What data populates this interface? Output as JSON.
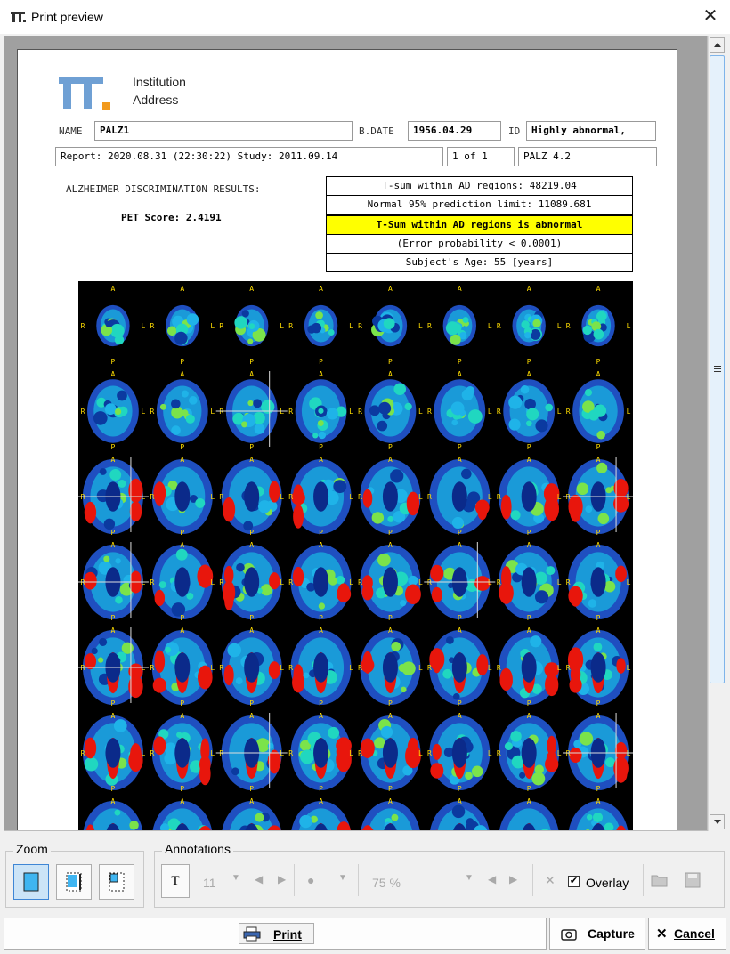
{
  "window": {
    "title": "Print preview",
    "close_symbol": "✕"
  },
  "report": {
    "institution_line1": "Institution",
    "institution_line2": "Address",
    "name_label": "NAME",
    "name_value": "PALZ1",
    "bdate_label": "B.DATE",
    "bdate_value": "1956.04.29",
    "id_label": "ID",
    "id_value": "Highly abnormal,",
    "report_line": "Report: 2020.08.31 (22:30:22)  Study: 2011.09.14",
    "page_counter": "1 of 1",
    "version": "PALZ 4.2",
    "results_title": "ALZHEIMER DISCRIMINATION RESULTS:",
    "pet_score": "PET Score: 2.4191",
    "results": [
      "T-sum within AD regions: 48219.04",
      "Normal 95% prediction limit: 11089.681",
      "T-Sum within AD regions is abnormal",
      "(Error probability < 0.0001)",
      "Subject's Age: 55 [years]"
    ],
    "orientation": {
      "anterior": "A",
      "posterior": "P",
      "right": "R",
      "left": "L"
    }
  },
  "zoom": {
    "title": "Zoom",
    "buttons": [
      "zoom-fit-page",
      "zoom-fit-width",
      "zoom-actual"
    ]
  },
  "annotations": {
    "title": "Annotations",
    "text_tool": "T",
    "font_size": "11",
    "opacity": "75 %",
    "overlay_label": "Overlay",
    "overlay_checked": true
  },
  "actions": {
    "print": "Print",
    "capture": "Capture",
    "cancel": "Cancel"
  },
  "colors": {
    "accent": "#3f86d5",
    "highlight": "#ffff00",
    "logo_blue": "#6fa0d4",
    "logo_orange": "#f29a1d"
  }
}
